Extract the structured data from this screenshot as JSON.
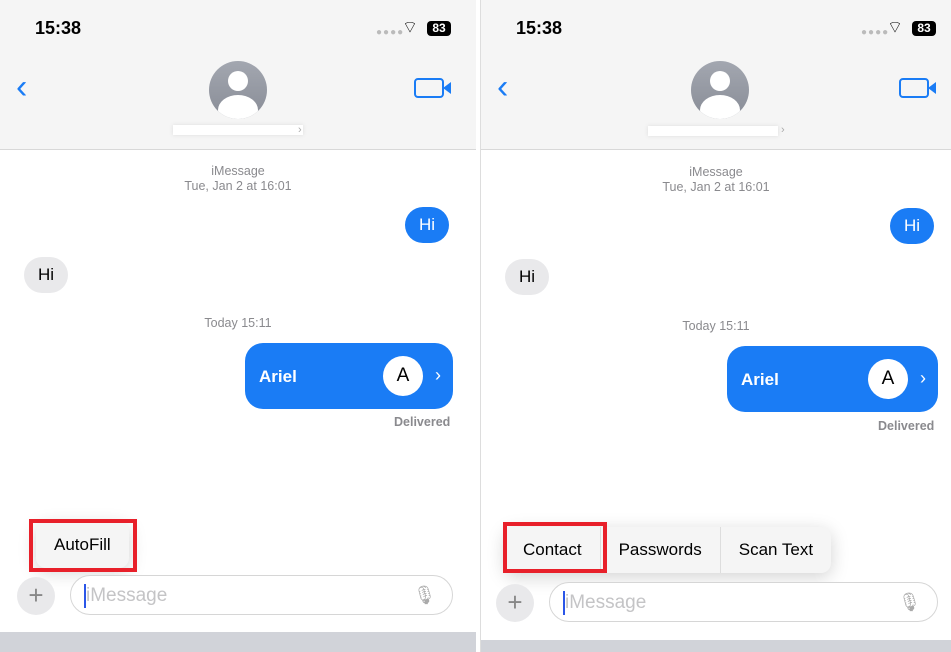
{
  "status": {
    "time": "15:38",
    "battery": "83",
    "signal_icon": "cellular-dots-icon",
    "wifi_icon": "wifi-icon"
  },
  "header": {
    "back_icon": "chevron-left-icon",
    "video_icon": "video-camera-icon",
    "avatar_icon": "person-avatar-icon"
  },
  "thread": {
    "service": "iMessage",
    "date1": "Tue, Jan 2 at 16:01",
    "msg_out": "Hi",
    "msg_in": "Hi",
    "date2": "Today 15:11",
    "contact_card": {
      "name": "Ariel",
      "initial": "A"
    },
    "delivered": "Delivered"
  },
  "composer": {
    "placeholder": "iMessage",
    "plus": "+"
  },
  "left_menu": {
    "items": [
      "AutoFill"
    ]
  },
  "right_menu": {
    "items": [
      "Contact",
      "Passwords",
      "Scan Text"
    ]
  },
  "colors": {
    "accent": "#1a7cf5",
    "highlight": "#e8202a"
  }
}
